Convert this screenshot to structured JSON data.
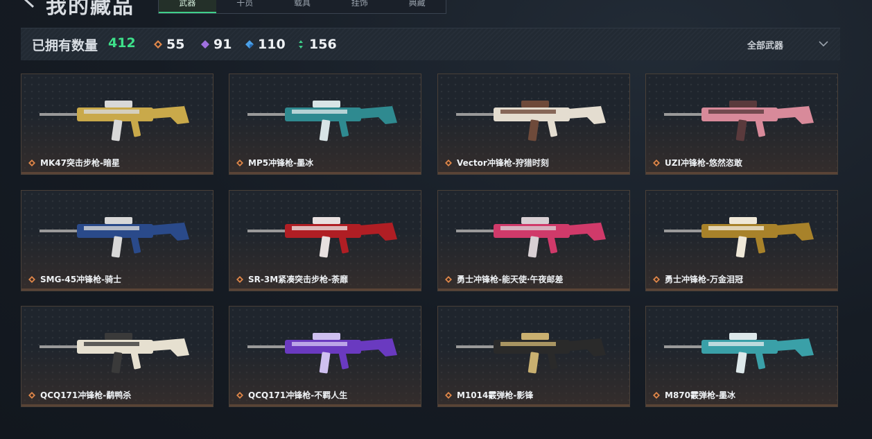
{
  "header": {
    "title": "我的藏品",
    "tabs": [
      "武器",
      "干员",
      "载具",
      "挂饰",
      "典藏"
    ],
    "active_tab": 0
  },
  "stats": {
    "owned_label": "已拥有数量",
    "owned_count": "412",
    "rarities": [
      {
        "icon": "orange-diamond-icon",
        "value": "55",
        "color": "#e0874a"
      },
      {
        "icon": "purple-diamond-icon",
        "value": "91",
        "color": "#a070e0"
      },
      {
        "icon": "blue-diamond-icon",
        "value": "110",
        "color": "#4aa0e8"
      },
      {
        "icon": "green-diamond-icon",
        "value": "156",
        "color": "#3ed08a"
      }
    ],
    "filter": "全部武器"
  },
  "items": [
    {
      "name": "MK47突击步枪-暗星",
      "colors": [
        "#c9a94a",
        "#d8d8d8"
      ]
    },
    {
      "name": "MP5冲锋枪-墨冰",
      "colors": [
        "#2f8a90",
        "#d8e4e6"
      ]
    },
    {
      "name": "Vector冲锋枪-狩猎时刻",
      "colors": [
        "#e4ddd0",
        "#6e4a3a"
      ]
    },
    {
      "name": "UZI冲锋枪-悠然恣敢",
      "colors": [
        "#d88a9a",
        "#5a3a3c"
      ]
    },
    {
      "name": "SMG-45冲锋枪-骑士",
      "colors": [
        "#2a4a8a",
        "#d8d8d8"
      ]
    },
    {
      "name": "SR-3M紧凑突击步枪-荼靡",
      "colors": [
        "#b01e24",
        "#e8e0e0"
      ]
    },
    {
      "name": "勇士冲锋枪-能天使·午夜邮差",
      "colors": [
        "#d03a6a",
        "#d8d0d4"
      ]
    },
    {
      "name": "勇士冲锋枪-万金泪冠",
      "colors": [
        "#a8822a",
        "#efe8d8"
      ]
    },
    {
      "name": "QCQ171冲锋枪-鹬鸭杀",
      "colors": [
        "#e6e0d0",
        "#3a3a3a"
      ]
    },
    {
      "name": "QCQ171冲锋枪-不羁人生",
      "colors": [
        "#6a3ac0",
        "#cfc0f0"
      ]
    },
    {
      "name": "M1014霰弹枪-影锋",
      "colors": [
        "#2a2a2a",
        "#c9b070"
      ]
    },
    {
      "name": "M870霰弹枪-墨冰",
      "colors": [
        "#3aa0a8",
        "#dde8ea"
      ]
    }
  ],
  "colors": {
    "accent": "#3ee08a",
    "card_border": "#4a4038"
  }
}
